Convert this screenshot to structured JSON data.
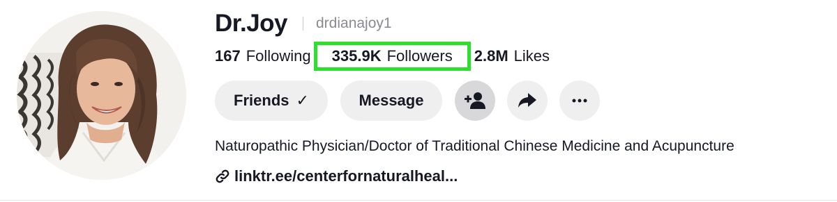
{
  "profile": {
    "display_name": "Dr.Joy",
    "username": "drdianajoy1"
  },
  "stats": {
    "following_count": "167",
    "following_label": "Following",
    "followers_count": "335.9K",
    "followers_label": "Followers",
    "likes_count": "2.8M",
    "likes_label": "Likes"
  },
  "actions": {
    "friends_label": "Friends",
    "friends_check": "✓",
    "message_label": "Message",
    "add_friend_icon": "add-person-icon",
    "share_icon": "share-arrow-icon",
    "more_icon": "more-dots-icon"
  },
  "bio": {
    "text": "Naturopathic Physician/Doctor of Traditional Chinese Medicine and Acupuncture",
    "link": "linktr.ee/centerfornaturalheal..."
  },
  "colors": {
    "highlight": "#2ee02e",
    "pill_bg": "#efeff0",
    "text": "#161823",
    "muted": "#8a8b91"
  }
}
